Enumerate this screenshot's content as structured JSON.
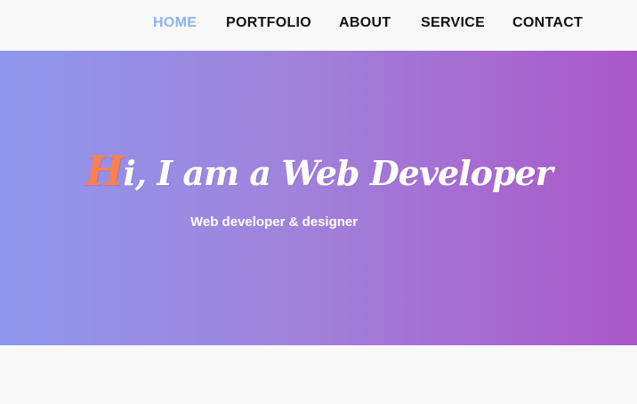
{
  "nav": {
    "items": [
      {
        "label": "HOME",
        "active": true
      },
      {
        "label": "PORTFOLIO",
        "active": false
      },
      {
        "label": "ABOUT",
        "active": false
      },
      {
        "label": "SERVICE",
        "active": false
      },
      {
        "label": "CONTACT",
        "active": false
      }
    ],
    "active_color": "#8ab4f0",
    "text_color": "#111111"
  },
  "hero": {
    "title_accent": "H",
    "title_rest": "i, I am a Web Developer",
    "subtitle": "Web developer & designer",
    "accent_color": "#ff7f4f",
    "gradient_start": "#8e97ee",
    "gradient_end": "#ab58c8"
  }
}
